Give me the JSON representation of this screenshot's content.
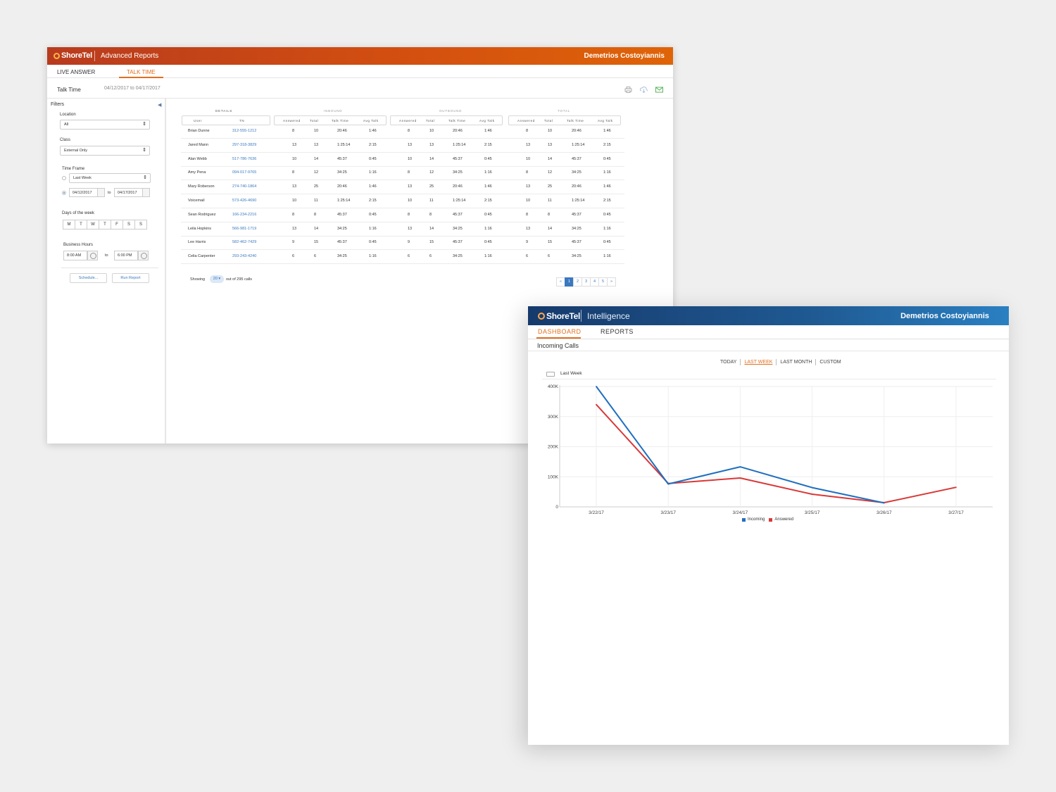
{
  "advanced_reports": {
    "brand": "ShoreTel",
    "app_title": "Advanced Reports",
    "user_name": "Demetrios Costoyiannis",
    "tabs": [
      {
        "label": "LIVE ANSWER"
      },
      {
        "label": "TALK TIME",
        "active": true
      }
    ],
    "page_title": "Talk Time",
    "date_range": "04/12/2017 to 04/17/2017",
    "toolbar_icons": [
      "print-icon",
      "download-icon",
      "email-icon"
    ],
    "filters": {
      "heading": "Filters",
      "location_label": "Location",
      "location_value": "All",
      "class_label": "Class",
      "class_value": "External Only",
      "time_frame_label": "Time Frame",
      "time_frame_value": "Last Week",
      "date_from": "04/12/2017",
      "date_to_word": "to",
      "date_to": "04/17/2017",
      "days_label": "Days of the week",
      "days": [
        "M",
        "T",
        "W",
        "T",
        "F",
        "S",
        "S"
      ],
      "hours_label": "Business Hours",
      "hours_from": "8:00 AM",
      "hours_to_word": "to",
      "hours_to": "6:00 PM",
      "schedule_button": "Schedule...",
      "run_button": "Run Report"
    },
    "table": {
      "groups": {
        "details": "DETAILS",
        "inbound": "INBOUND",
        "outbound": "OUTBOUND",
        "total": "TOTAL"
      },
      "columns": {
        "user": "User",
        "tn": "TN",
        "answered": "Answered",
        "total": "Total",
        "talk_time": "Talk Time",
        "avg_talk": "Avg Talk"
      },
      "rows": [
        {
          "user": "Brian Dunne",
          "tn": "312-555-1212",
          "ia": "8",
          "it": "10",
          "itt": "20:46",
          "iavg": "1:46",
          "oa": "8",
          "ot": "10",
          "ott": "20:46",
          "oavg": "1:46",
          "ta": "8",
          "tt": "10",
          "ttt": "20:46",
          "tavg": "1:46"
        },
        {
          "user": "Jared Mann",
          "tn": "297-318-3829",
          "ia": "13",
          "it": "13",
          "itt": "1:25:14",
          "iavg": "2:15",
          "oa": "13",
          "ot": "13",
          "ott": "1:25:14",
          "oavg": "2:15",
          "ta": "13",
          "tt": "13",
          "ttt": "1:25:14",
          "tavg": "2:15"
        },
        {
          "user": "Alan Webb",
          "tn": "517-786-7636",
          "ia": "10",
          "it": "14",
          "itt": "45:37",
          "iavg": "0:45",
          "oa": "10",
          "ot": "14",
          "ott": "45:37",
          "oavg": "0:45",
          "ta": "10",
          "tt": "14",
          "ttt": "45:37",
          "tavg": "0:45"
        },
        {
          "user": "Amy Pena",
          "tn": "094-017-9765",
          "ia": "8",
          "it": "12",
          "itt": "34:25",
          "iavg": "1:16",
          "oa": "8",
          "ot": "12",
          "ott": "34:25",
          "oavg": "1:16",
          "ta": "8",
          "tt": "12",
          "ttt": "34:25",
          "tavg": "1:16"
        },
        {
          "user": "Mary Roberson",
          "tn": "274-740-1864",
          "ia": "13",
          "it": "25",
          "itt": "20:46",
          "iavg": "1:46",
          "oa": "13",
          "ot": "25",
          "ott": "20:46",
          "oavg": "1:46",
          "ta": "13",
          "tt": "25",
          "ttt": "20:46",
          "tavg": "1:46"
        },
        {
          "user": "Voicemail",
          "tn": "573-426-4690",
          "ia": "10",
          "it": "11",
          "itt": "1:25:14",
          "iavg": "2:15",
          "oa": "10",
          "ot": "11",
          "ott": "1:25:14",
          "oavg": "2:15",
          "ta": "10",
          "tt": "11",
          "ttt": "1:25:14",
          "tavg": "2:15"
        },
        {
          "user": "Sean Rodriguez",
          "tn": "166-234-2216",
          "ia": "8",
          "it": "8",
          "itt": "45:37",
          "iavg": "0:45",
          "oa": "8",
          "ot": "8",
          "ott": "45:37",
          "oavg": "0:45",
          "ta": "8",
          "tt": "8",
          "ttt": "45:37",
          "tavg": "0:45"
        },
        {
          "user": "Leila Hopkins",
          "tn": "566-981-1719",
          "ia": "13",
          "it": "14",
          "itt": "34:25",
          "iavg": "1:16",
          "oa": "13",
          "ot": "14",
          "ott": "34:25",
          "oavg": "1:16",
          "ta": "13",
          "tt": "14",
          "ttt": "34:25",
          "tavg": "1:16"
        },
        {
          "user": "Lee Harris",
          "tn": "582-462-7429",
          "ia": "9",
          "it": "15",
          "itt": "45:37",
          "iavg": "0:45",
          "oa": "9",
          "ot": "15",
          "ott": "45:37",
          "oavg": "0:45",
          "ta": "9",
          "tt": "15",
          "ttt": "45:37",
          "tavg": "0:45"
        },
        {
          "user": "Celia Carpenter",
          "tn": "293-243-4240",
          "ia": "6",
          "it": "6",
          "itt": "34:25",
          "iavg": "1:16",
          "oa": "6",
          "ot": "6",
          "ott": "34:25",
          "oavg": "1:16",
          "ta": "6",
          "tt": "6",
          "ttt": "34:25",
          "tavg": "1:16"
        }
      ],
      "footer": {
        "showing": "Showing",
        "per_page": "20",
        "of_text": "out of 295 calls"
      },
      "pager": [
        "«",
        "1",
        "2",
        "3",
        "4",
        "5",
        "»"
      ],
      "pager_active": "1"
    }
  },
  "intelligence": {
    "brand": "ShoreTel",
    "app_title": "Intelligence",
    "user_name": "Demetrios Costoyiannis",
    "tabs": [
      {
        "label": "DASHBOARD",
        "active": true
      },
      {
        "label": "REPORTS"
      }
    ],
    "subtitle": "Incoming Calls",
    "range_tabs": [
      "TODAY",
      "LAST WEEK",
      "LAST MONTH",
      "CUSTOM"
    ],
    "range_active": "LAST WEEK",
    "panel_title": "Last Week"
  },
  "chart_data": {
    "type": "line",
    "title": "Last Week",
    "categories": [
      "3/22/17",
      "3/23/17",
      "3/24/17",
      "3/25/17",
      "3/26/17",
      "3/27/17"
    ],
    "y_ticks": [
      "0",
      "100K",
      "200K",
      "300K",
      "400K"
    ],
    "ylim": [
      0,
      400000
    ],
    "grid": true,
    "legend": "bottom-center",
    "series": [
      {
        "name": "Incoming",
        "color": "#1f6fbf",
        "values": [
          400000,
          76000,
          133000,
          64000,
          13000,
          null
        ]
      },
      {
        "name": "Answered",
        "color": "#d93838",
        "values": [
          340000,
          78000,
          96000,
          42000,
          14000,
          65000
        ]
      }
    ]
  }
}
